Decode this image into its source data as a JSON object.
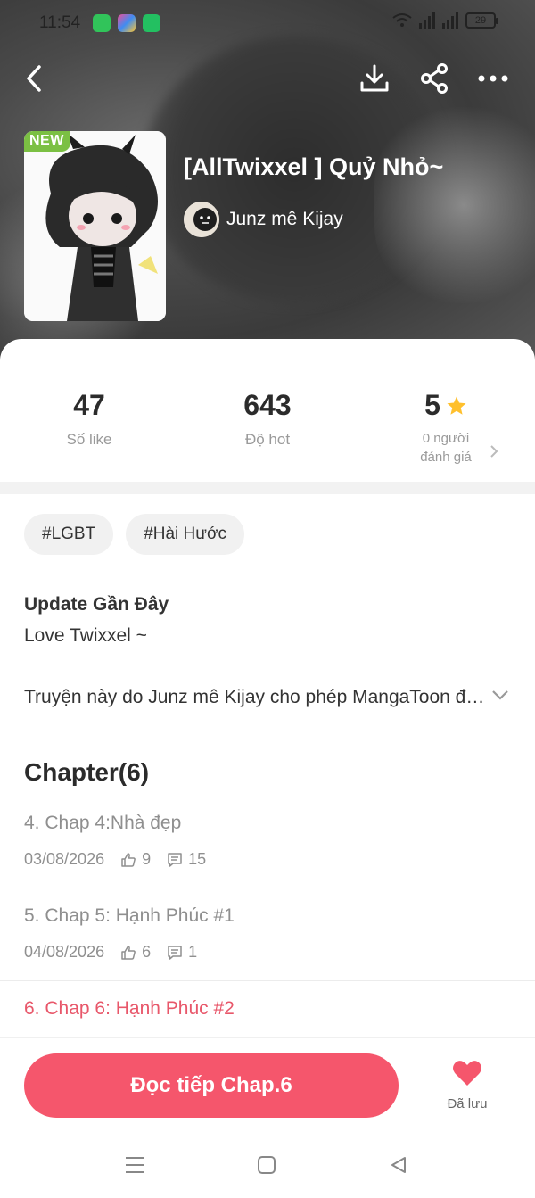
{
  "status_bar": {
    "time": "11:54",
    "battery": "29",
    "app_colors": [
      "#31c45a",
      "#f04e98",
      "#23c061"
    ]
  },
  "header": {
    "back_icon": "chevron-left-icon",
    "download_icon": "download-icon",
    "share_icon": "share-icon",
    "more_icon": "more-dots-icon"
  },
  "book": {
    "badge": "NEW",
    "title": "[AllTwixxel ] Quỷ Nhỏ~",
    "author": "Junz mê Kijay"
  },
  "stats": {
    "likes_value": "47",
    "likes_label": "Số like",
    "hot_value": "643",
    "hot_label": "Độ hot",
    "rating_value": "5",
    "rating_label_line1": "0 người",
    "rating_label_line2": "đánh giá"
  },
  "tags": [
    "#LGBT",
    "#Hài Hước"
  ],
  "update": {
    "title": "Update Gần Đây",
    "description": "Love Twixxel ~"
  },
  "license_text": "Truyện này do Junz mê Kijay cho phép MangaToon đăng tải",
  "chapters": {
    "heading": "Chapter(6)",
    "items": [
      {
        "title": "4. Chap 4:Nhà đẹp",
        "date": "03/08/2026",
        "likes": "9",
        "comments": "15"
      },
      {
        "title": "5. Chap 5: Hạnh Phúc #1",
        "date": "04/08/2026",
        "likes": "6",
        "comments": "1"
      },
      {
        "title": "6. Chap 6: Hạnh Phúc #2"
      }
    ]
  },
  "bottom": {
    "read_button": "Đọc tiếp Chap.6",
    "save_label": "Đã lưu",
    "accent_color": "#f5566c"
  }
}
